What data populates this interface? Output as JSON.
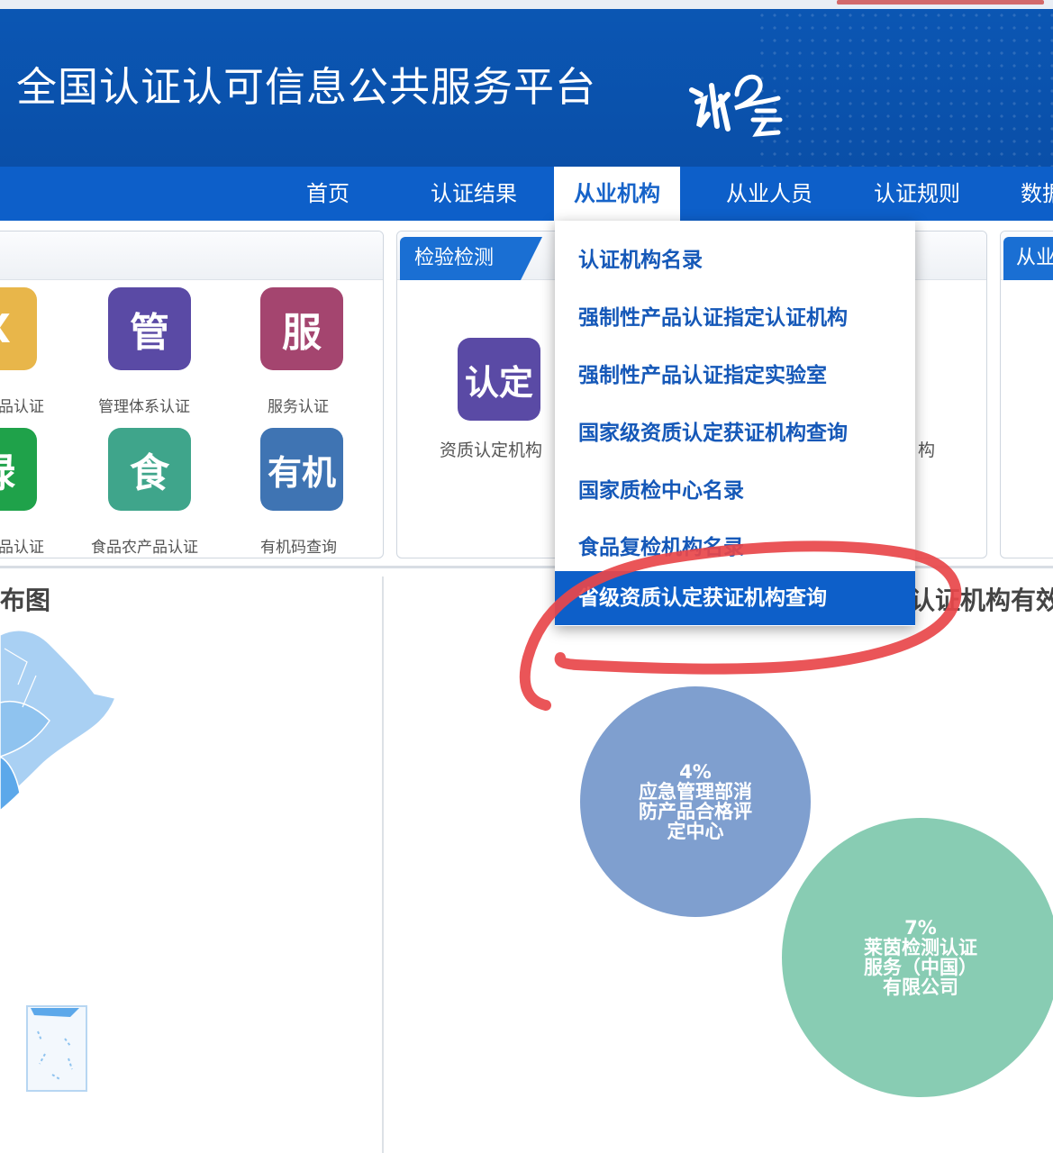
{
  "header": {
    "title": "全国认证认可信息公共服务平台",
    "logo_text": "认证云"
  },
  "nav": {
    "items": [
      "首页",
      "认证结果",
      "从业机构",
      "从业人员",
      "认证规则",
      "数据"
    ],
    "active": "从业机构"
  },
  "panels": {
    "left": {
      "tiles": [
        {
          "glyph": "X",
          "label": "产品认证",
          "color": "#e8b64a"
        },
        {
          "glyph": "管",
          "label": "管理体系认证",
          "color": "#5a4aa5"
        },
        {
          "glyph": "服",
          "label": "服务认证",
          "color": "#a4456f"
        },
        {
          "glyph": "绿",
          "label": "产品认证",
          "color": "#1fa24a"
        },
        {
          "glyph": "食",
          "label": "食品农产品认证",
          "color": "#3fa58b"
        },
        {
          "glyph": "有机",
          "label": "有机码查询",
          "color": "#3f74b3"
        }
      ]
    },
    "middle": {
      "tab": "检验检测",
      "tiles": [
        {
          "glyph": "认定",
          "label": "资质认定机构",
          "color": "#5a4aa5"
        }
      ],
      "partial_label": "构"
    },
    "right": {
      "tab": "从业"
    }
  },
  "dropdown": {
    "items": [
      "认证机构名录",
      "强制性产品认证指定认证机构",
      "强制性产品认证指定实验室",
      "国家级资质认定获证机构查询",
      "国家质检中心名录",
      "食品复检机构名录",
      "省级资质认定获证机构查询"
    ],
    "highlighted": "省级资质认定获证机构查询"
  },
  "sections": {
    "left_title": "布图",
    "right_title": "认证机构有效"
  },
  "bubbles": [
    {
      "pct": "4%",
      "lines": [
        "应急管理部消",
        "防产品合格评",
        "定中心"
      ],
      "color": "#7f9fcf"
    },
    {
      "pct": "7%",
      "lines": [
        "莱茵检测认证",
        "服务（中国）",
        "有限公司"
      ],
      "color": "#88ccb3"
    }
  ]
}
